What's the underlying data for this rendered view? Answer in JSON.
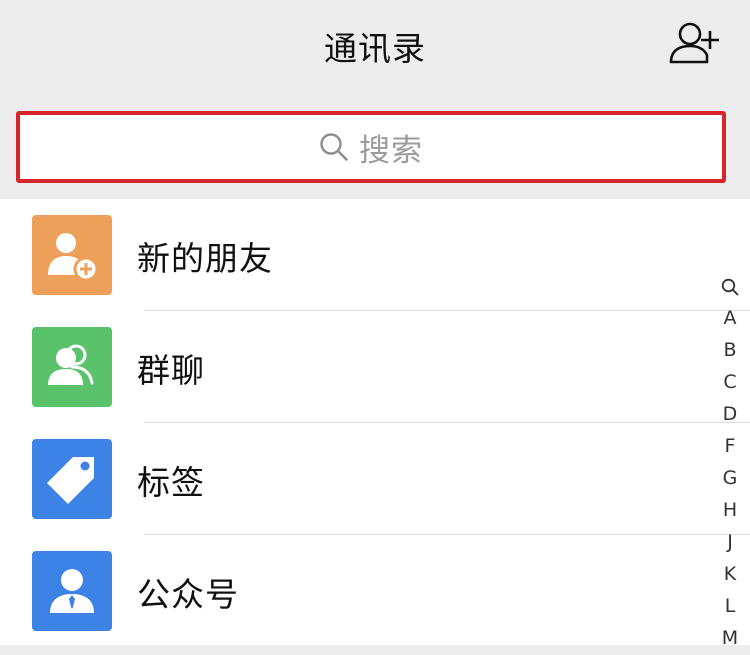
{
  "header": {
    "title": "通讯录",
    "add_contact_icon": "add-user-icon"
  },
  "search": {
    "placeholder": "搜索",
    "icon": "search-icon"
  },
  "entries": [
    {
      "label": "新的朋友",
      "icon": "new-friend-icon",
      "color": "#eca05a"
    },
    {
      "label": "群聊",
      "icon": "group-chat-icon",
      "color": "#5ac26b"
    },
    {
      "label": "标签",
      "icon": "tag-icon",
      "color": "#3d82e5"
    },
    {
      "label": "公众号",
      "icon": "official-account-icon",
      "color": "#3d82e5"
    }
  ],
  "index_bar": {
    "search_icon": "search-icon",
    "letters": [
      "A",
      "B",
      "C",
      "D",
      "F",
      "G",
      "H",
      "J",
      "K",
      "L",
      "M"
    ]
  }
}
